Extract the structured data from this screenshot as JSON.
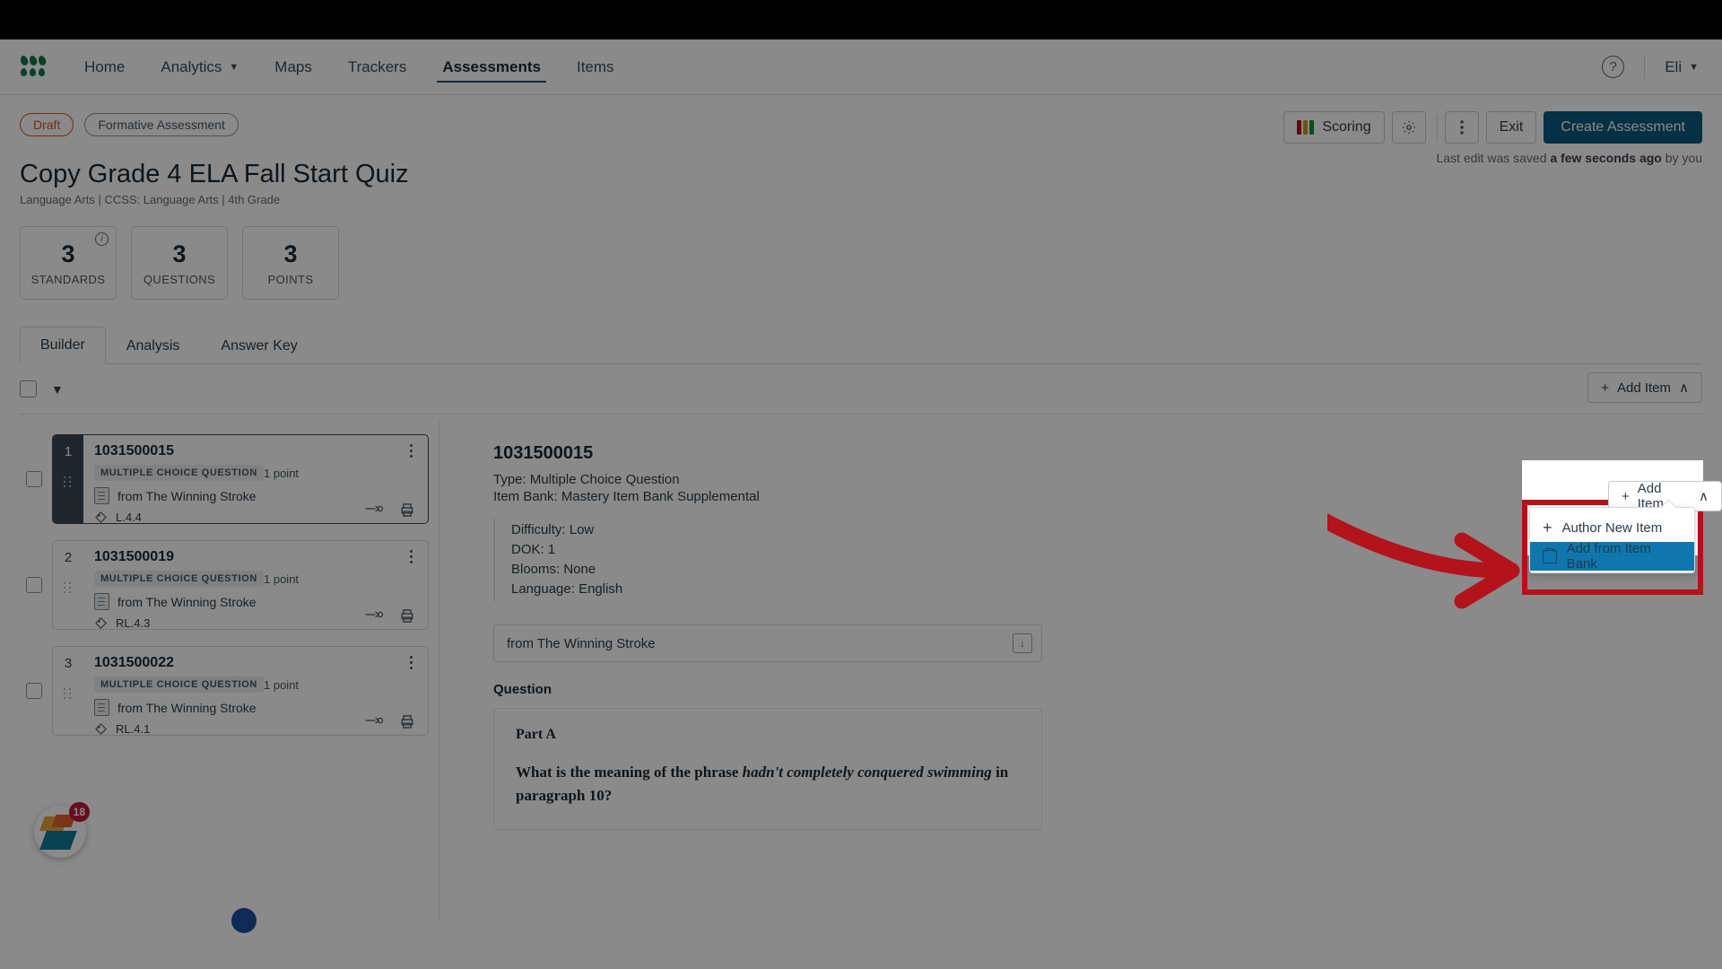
{
  "nav": {
    "logo_icon": "clover-logo",
    "items": [
      {
        "label": "Home",
        "has_caret": false
      },
      {
        "label": "Analytics",
        "has_caret": true
      },
      {
        "label": "Maps",
        "has_caret": false
      },
      {
        "label": "Trackers",
        "has_caret": false
      },
      {
        "label": "Assessments",
        "has_caret": false
      },
      {
        "label": "Items",
        "has_caret": false
      }
    ],
    "help_icon": "question-circle-icon",
    "user": "Eli",
    "user_caret": "⌄"
  },
  "toolbar": {
    "status_badge": "Draft",
    "type_badge": "Formative Assessment",
    "scoring_label": "Scoring",
    "scoring_colors": [
      "#b3131b",
      "#c8972b",
      "#1f8a3c"
    ],
    "settings_icon": "gear-icon",
    "more_icon": "kebab-menu-icon",
    "exit_label": "Exit",
    "create_label": "Create Assessment",
    "saved_prefix": "Last edit was saved ",
    "saved_bold": "a few seconds ago",
    "saved_suffix": " by you"
  },
  "header": {
    "title": "Copy Grade 4 ELA Fall Start Quiz",
    "subtitle": "Language Arts  |  CCSS: Language Arts  |  4th Grade"
  },
  "stats": [
    {
      "value": "3",
      "label": "STANDARDS",
      "info_icon": "info-icon"
    },
    {
      "value": "3",
      "label": "QUESTIONS"
    },
    {
      "value": "3",
      "label": "POINTS"
    }
  ],
  "tabs": [
    {
      "label": "Builder",
      "active": true
    },
    {
      "label": "Analysis",
      "active": false
    },
    {
      "label": "Answer Key",
      "active": false
    }
  ],
  "listbar": {
    "select_all_icon": "checkbox-unchecked",
    "chevron_icon": "⌄",
    "add_item_label": "Add Item",
    "add_item_plus": "+",
    "add_item_chevron": "∧"
  },
  "menu": {
    "items": [
      {
        "label": "Author New Item",
        "icon": "plus-icon",
        "highlighted": false
      },
      {
        "label": "Add from Item Bank",
        "icon": "item-bank-icon",
        "highlighted": true
      }
    ]
  },
  "items": [
    {
      "number": "1",
      "id": "1031500015",
      "type": "MULTIPLE CHOICE QUESTION",
      "points": "1 point",
      "passage": "from The Winning Stroke",
      "standard": "L.4.4",
      "selected": true
    },
    {
      "number": "2",
      "id": "1031500019",
      "type": "MULTIPLE CHOICE QUESTION",
      "points": "1 point",
      "passage": "from The Winning Stroke",
      "standard": "RL.4.3",
      "selected": false
    },
    {
      "number": "3",
      "id": "1031500022",
      "type": "MULTIPLE CHOICE QUESTION",
      "points": "1 point",
      "passage": "from The Winning Stroke",
      "standard": "RL.4.1",
      "selected": false
    }
  ],
  "detail": {
    "id": "1031500015",
    "type_line": "Type: Multiple Choice Question",
    "bank_line": "Item Bank: Mastery Item Bank Supplemental",
    "meta": [
      "Difficulty: Low",
      "DOK: 1",
      "Blooms: None",
      "Language: English"
    ],
    "passage": "from The Winning Stroke",
    "passage_icon": "download-icon",
    "question_label": "Question",
    "part_label": "Part A",
    "question_pre": "What is the meaning of the phrase ",
    "question_italic": "hadn't completely conquered swimming",
    "question_post": " in paragraph 10?"
  },
  "fab": {
    "badge": "18",
    "icon": "diamond-stack-icon"
  },
  "annotation": {
    "arrow_color": "#b3131b",
    "box_color": "#b3131b"
  }
}
